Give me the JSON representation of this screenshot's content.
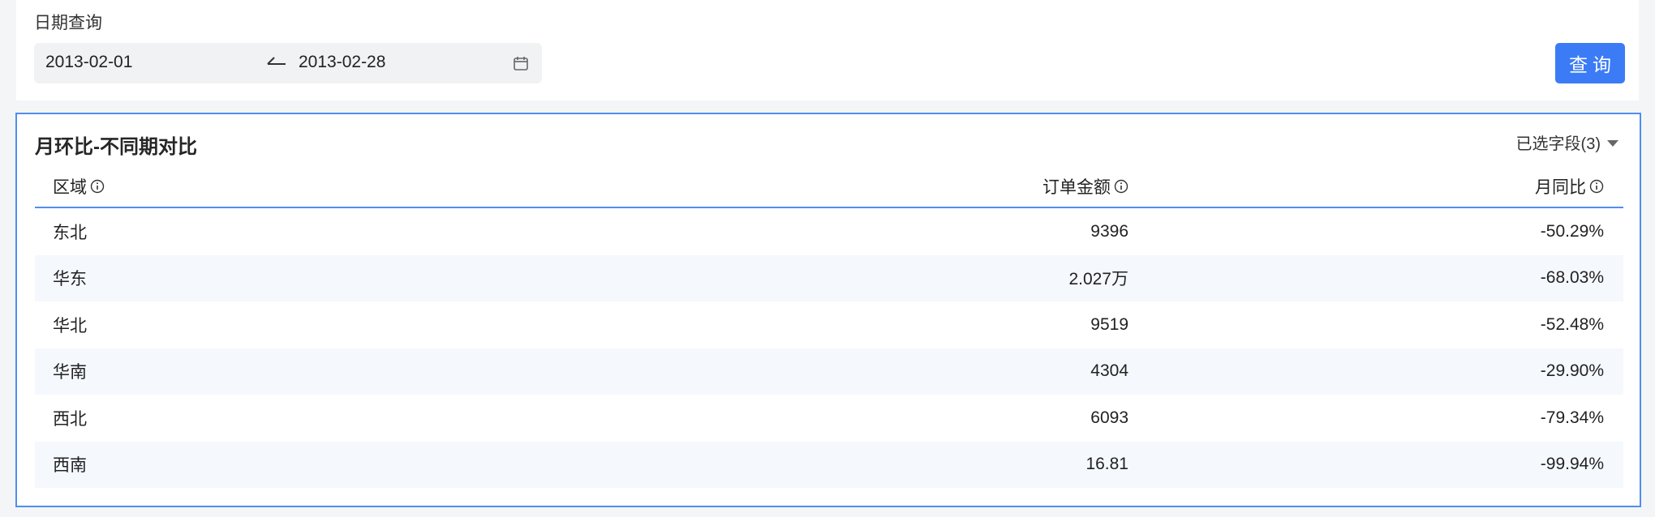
{
  "filter": {
    "label": "日期查询",
    "date_start": "2013-02-01",
    "date_end": "2013-02-28",
    "query_button": "查询"
  },
  "card": {
    "title": "月环比-不同期对比",
    "field_select": "已选字段(3)"
  },
  "table": {
    "headers": {
      "region": "区域",
      "amount": "订单金额",
      "ratio": "月同比"
    },
    "rows": [
      {
        "region": "东北",
        "amount": "9396",
        "ratio": "-50.29%"
      },
      {
        "region": "华东",
        "amount": "2.027万",
        "ratio": "-68.03%"
      },
      {
        "region": "华北",
        "amount": "9519",
        "ratio": "-52.48%"
      },
      {
        "region": "华南",
        "amount": "4304",
        "ratio": "-29.90%"
      },
      {
        "region": "西北",
        "amount": "6093",
        "ratio": "-79.34%"
      },
      {
        "region": "西南",
        "amount": "16.81",
        "ratio": "-99.94%"
      }
    ]
  },
  "colors": {
    "accent": "#3b7cf6",
    "border": "#4f8ef0",
    "row_alt": "#f5f8fd"
  }
}
